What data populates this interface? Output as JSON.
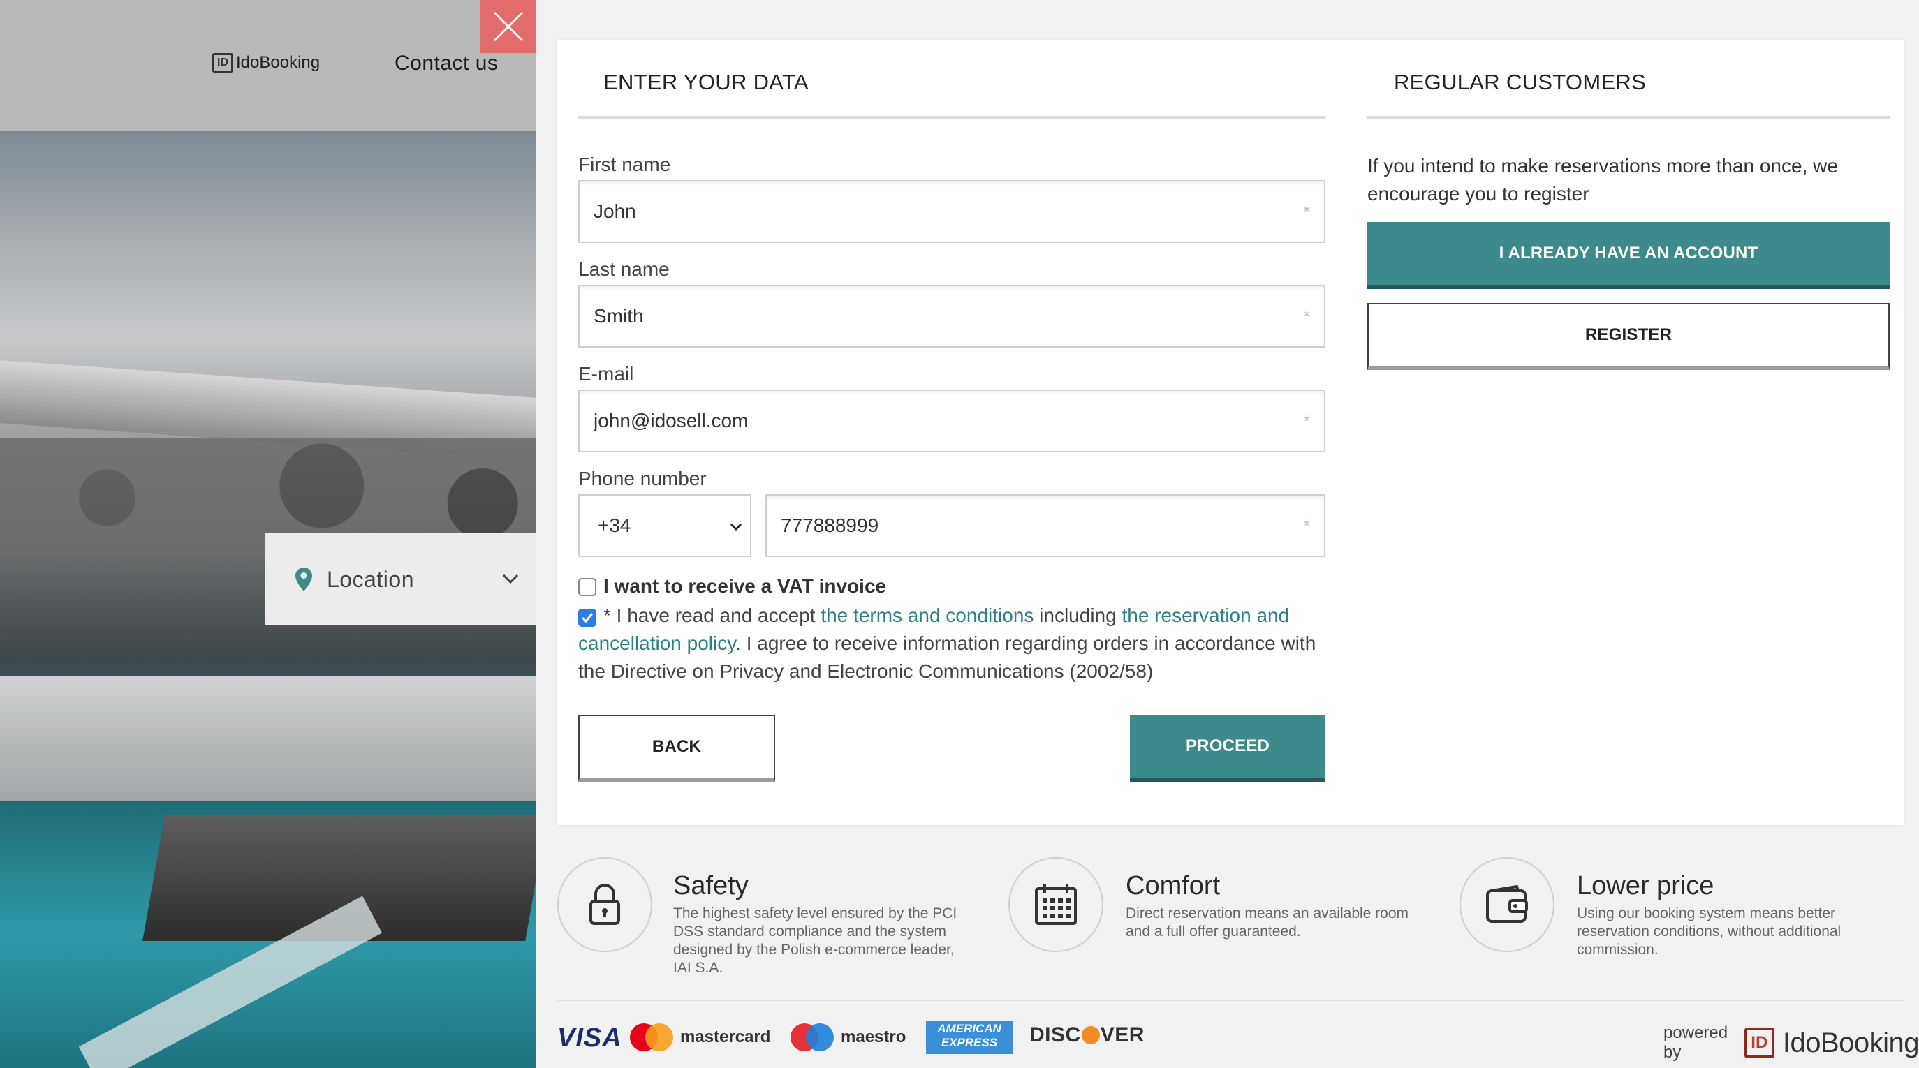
{
  "background": {
    "logo_text": "IdoBooking",
    "contact_label": "Contact us",
    "location_label": "Location"
  },
  "close_icon": "close-icon",
  "form": {
    "title": "ENTER YOUR DATA",
    "first_name": {
      "label": "First name",
      "value": "John"
    },
    "last_name": {
      "label": "Last name",
      "value": "Smith"
    },
    "email": {
      "label": "E-mail",
      "value": "john@idosell.com"
    },
    "phone": {
      "label": "Phone number",
      "prefix": "+34",
      "value": "777888999"
    },
    "required_mark": "*",
    "vat_label": "I want to receive a VAT invoice",
    "vat_checked": false,
    "terms_checked": true,
    "terms": {
      "prefix": "* I have read and accept ",
      "link1": "the terms and conditions",
      "middle": " including ",
      "link2": "the reservation and cancellation policy",
      "suffix": ". I agree to receive information regarding orders in accordance with the Directive on Privacy and Electronic Communications (2002/58)"
    },
    "back_label": "BACK",
    "proceed_label": "PROCEED"
  },
  "regular": {
    "title": "REGULAR CUSTOMERS",
    "text": "If you intend to make reservations more than once, we encourage you to register",
    "login_label": "I ALREADY HAVE AN ACCOUNT",
    "register_label": "REGISTER"
  },
  "features": [
    {
      "icon": "lock-icon",
      "title": "Safety",
      "desc": "The highest safety level ensured by the PCI DSS standard compliance and the system designed by the Polish e-commerce leader, IAI S.A."
    },
    {
      "icon": "calendar-icon",
      "title": "Comfort",
      "desc": "Direct reservation means an available room and a full offer guaranteed."
    },
    {
      "icon": "wallet-icon",
      "title": "Lower price",
      "desc": "Using our booking system means better reservation conditions, without additional commission."
    }
  ],
  "payments": {
    "visa": "VISA",
    "mastercard": "mastercard",
    "maestro": "maestro",
    "amex_line1": "AMERICAN",
    "amex_line2": "EXPRESS",
    "discover_a": "DISC",
    "discover_b": "VER"
  },
  "powered": {
    "label": "powered by",
    "brand": "IdoBooking"
  },
  "colors": {
    "accent": "#3c8a8c",
    "close": "#e26b6b",
    "link": "#2d8086"
  }
}
